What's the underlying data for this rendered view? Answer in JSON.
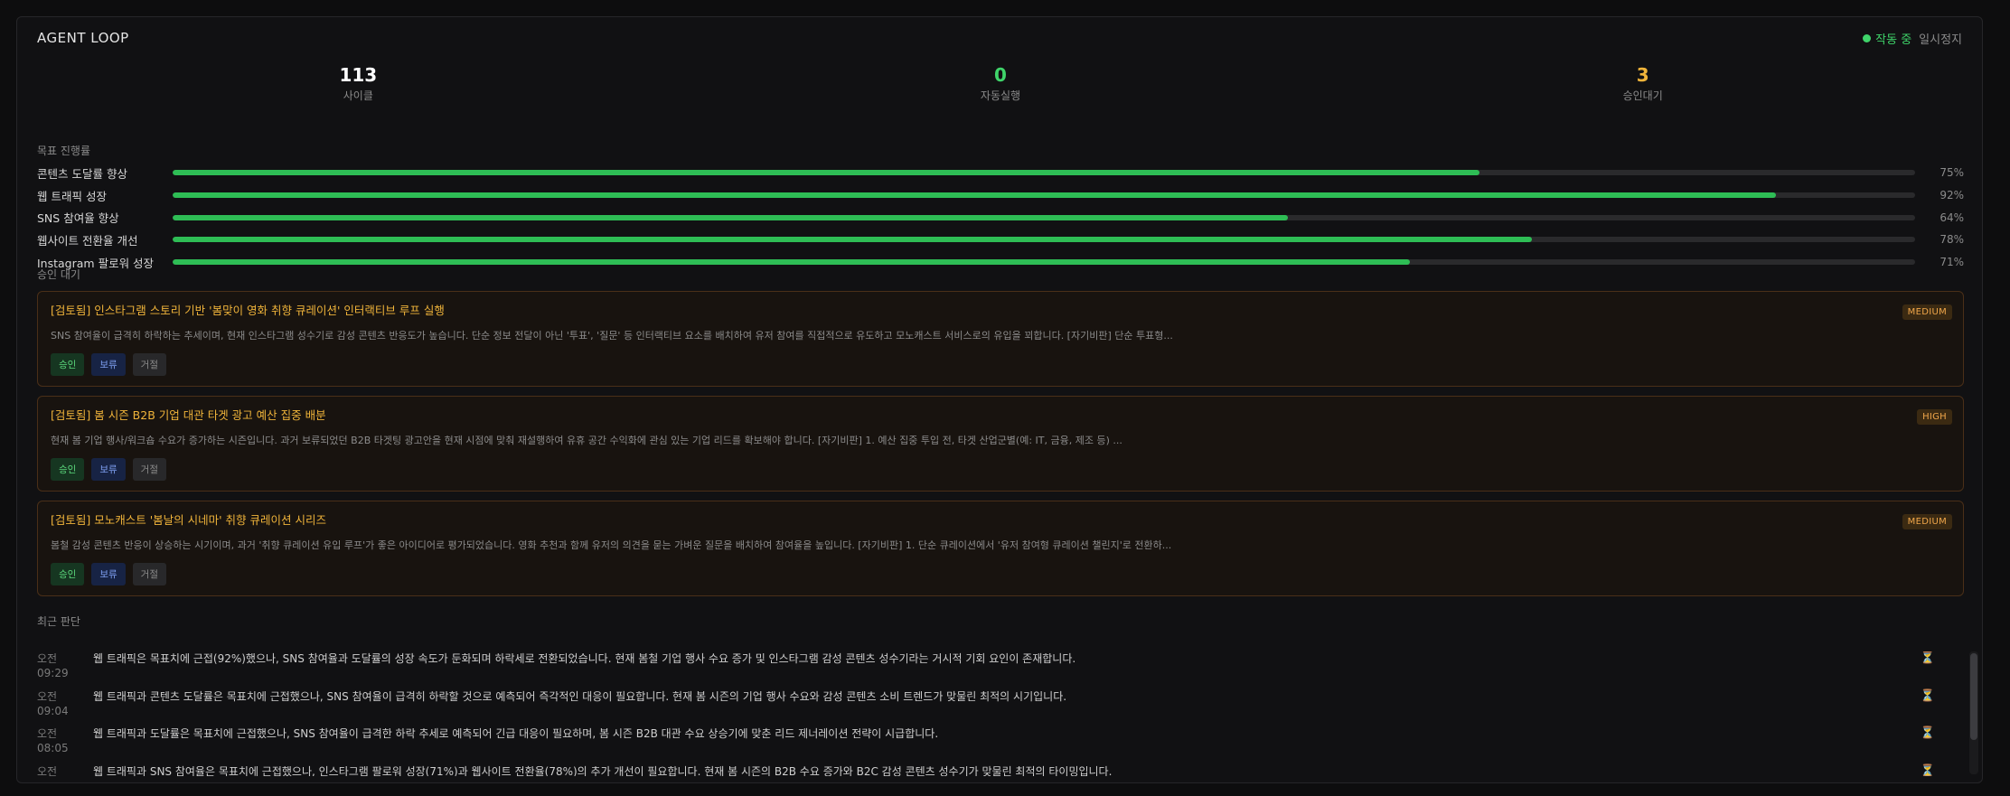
{
  "header": {
    "title": "AGENT LOOP",
    "status_label": "작동 중",
    "status_color": "#3fd46a",
    "pause_label": "일시정지"
  },
  "stats": [
    {
      "value": "113",
      "label": "사이클",
      "color": "#ffffff"
    },
    {
      "value": "0",
      "label": "자동실행",
      "color": "#3fd46a"
    },
    {
      "value": "3",
      "label": "승인대기",
      "color": "#f0b43a"
    }
  ],
  "goals_label": "목표 진행률",
  "goals": [
    {
      "name": "콘텐츠 도달률 향상",
      "percent": 75,
      "percent_label": "75%"
    },
    {
      "name": "웹 트래픽 성장",
      "percent": 92,
      "percent_label": "92%"
    },
    {
      "name": "SNS 참여율 향상",
      "percent": 64,
      "percent_label": "64%"
    },
    {
      "name": "웹사이트 전환율 개선",
      "percent": 78,
      "percent_label": "78%"
    },
    {
      "name": "Instagram 팔로워 성장",
      "percent": 71,
      "percent_label": "71%"
    }
  ],
  "approvals_label": "승인 대기",
  "approvals": [
    {
      "title": "[검토됨] 인스타그램 스토리 기반 '봄맞이 영화 취향 큐레이션' 인터랙티브 루프 실행",
      "description": "SNS 참여율이 급격히 하락하는 추세이며, 현재 인스타그램 성수기로 감성 콘텐츠 반응도가 높습니다. 단순 정보 전달이 아닌 '투표', '질문' 등 인터랙티브 요소를 배치하여 유저 참여를 직접적으로 유도하고 모노캐스트 서비스로의 유입을 꾀합니다. [자기비판] 단순 투표형...",
      "priority": "MEDIUM",
      "approve_label": "승인",
      "hold_label": "보류",
      "reject_label": "거절"
    },
    {
      "title": "[검토됨] 봄 시즌 B2B 기업 대관 타겟 광고 예산 집중 배분",
      "description": "현재 봄 기업 행사/워크숍 수요가 증가하는 시즌입니다. 과거 보류되었던 B2B 타겟팅 광고안을 현재 시점에 맞춰 재설행하여 유휴 공간 수익화에 관심 있는 기업 리드를 확보해야 합니다. [자기비판] 1. 예산 집중 투입 전, 타겟 산업군별(예: IT, 금융, 제조 등) ...",
      "priority": "HIGH",
      "approve_label": "승인",
      "hold_label": "보류",
      "reject_label": "거절"
    },
    {
      "title": "[검토됨] 모노캐스트 '봄날의 시네마' 취향 큐레이션 시리즈",
      "description": "봄철 감성 콘텐츠 반응이 상승하는 시기이며, 과거 '취향 큐레이션 유입 루프'가 좋은 아이디어로 평가되었습니다. 영화 추천과 함께 유저의 의견을 묻는 가벼운 질문을 배치하여 참여율을 높입니다. [자기비판] 1. 단순 큐레이션에서 '유저 참여형 큐레이션 챌린지'로 전환하...",
      "priority": "MEDIUM",
      "approve_label": "승인",
      "hold_label": "보류",
      "reject_label": "거절"
    }
  ],
  "log_label": "최근 판단",
  "log": [
    {
      "time_ampm": "오전",
      "time": "09:29",
      "message": "웹 트래픽은 목표치에 근접(92%)했으나, SNS 참여율과 도달률의 성장 속도가 둔화되며 하락세로 전환되었습니다. 현재 봄철 기업 행사 수요 증가 및 인스타그램 감성 콘텐츠 성수기라는 거시적 기회 요인이 존재합니다.",
      "icon": "hourglass-icon"
    },
    {
      "time_ampm": "오전",
      "time": "09:04",
      "message": "웹 트래픽과 콘텐츠 도달률은 목표치에 근접했으나, SNS 참여율이 급격히 하락할 것으로 예측되어 즉각적인 대응이 필요합니다. 현재 봄 시즌의 기업 행사 수요와 감성 콘텐츠 소비 트렌드가 맞물린 최적의 시기입니다.",
      "icon": "hourglass-icon"
    },
    {
      "time_ampm": "오전",
      "time": "08:05",
      "message": "웹 트래픽과 도달률은 목표치에 근접했으나, SNS 참여율이 급격한 하락 추세로 예측되어 긴급 대응이 필요하며, 봄 시즌 B2B 대관 수요 상승기에 맞춘 리드 제너레이션 전략이 시급합니다.",
      "icon": "hourglass-icon"
    },
    {
      "time_ampm": "오전",
      "time": "",
      "message": "웹 트래픽과 SNS 참여율은 목표치에 근접했으나, 인스타그램 팔로워 성장(71%)과 웹사이트 전환율(78%)의 추가 개선이 필요합니다. 현재 봄 시즌의 B2B 수요 증가와 B2C 감성 콘텐츠 성수기가 맞물린 최적의 타이밍입니다.",
      "icon": "hourglass-icon"
    }
  ]
}
